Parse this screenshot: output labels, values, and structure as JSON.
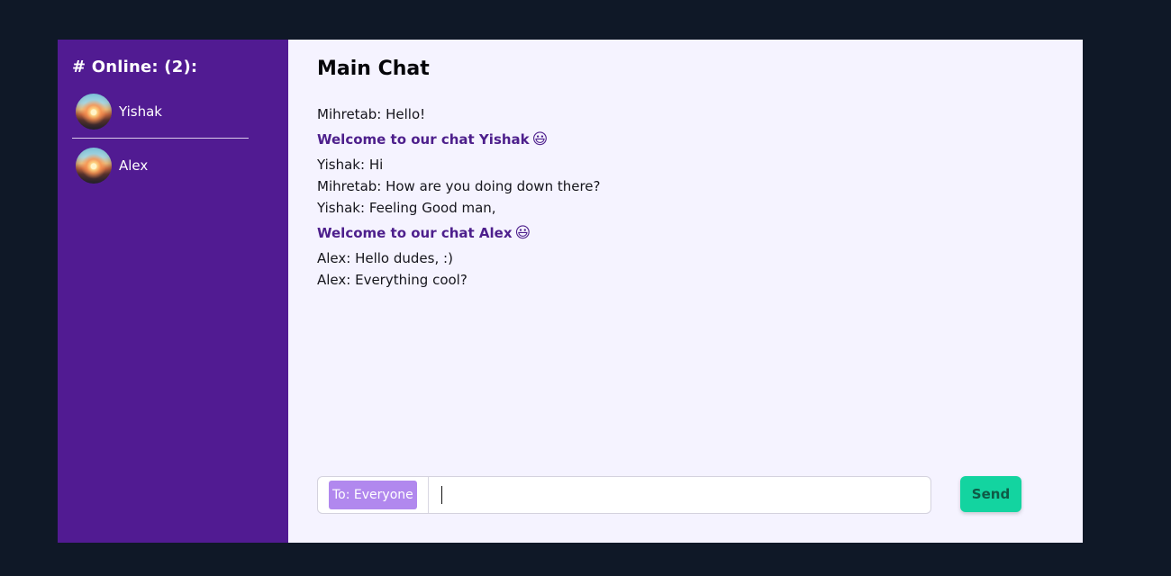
{
  "sidebar": {
    "title": "# Online: (2):",
    "users": [
      {
        "name": "Yishak",
        "avatar_icon": "avatar-sunset-image"
      },
      {
        "name": "Alex",
        "avatar_icon": "avatar-sunset-image"
      }
    ]
  },
  "main": {
    "title": "Main Chat",
    "messages": [
      {
        "type": "message",
        "text": "Mihretab: Hello!"
      },
      {
        "type": "welcome",
        "text": "Welcome to our chat Yishak",
        "emoji": "😃"
      },
      {
        "type": "message",
        "text": "Yishak: Hi"
      },
      {
        "type": "message",
        "text": "Mihretab: How are you doing down there?"
      },
      {
        "type": "message",
        "text": "Yishak: Feeling Good man,"
      },
      {
        "type": "welcome",
        "text": "Welcome to our chat Alex",
        "emoji": "😃"
      },
      {
        "type": "message",
        "text": "Alex: Hello dudes, :)"
      },
      {
        "type": "message",
        "text": "Alex: Everything cool?"
      }
    ]
  },
  "composer": {
    "recipient": "To: Everyone",
    "input_value": "",
    "input_placeholder": "",
    "send_label": "Send"
  },
  "colors": {
    "page_background": "#0f1827",
    "sidebar_background": "#511b92",
    "chat_background": "#f5f3ff",
    "welcome_text": "#4d1f8c",
    "recipient_chip": "#b188ee",
    "send_button": "#13d4a0"
  }
}
